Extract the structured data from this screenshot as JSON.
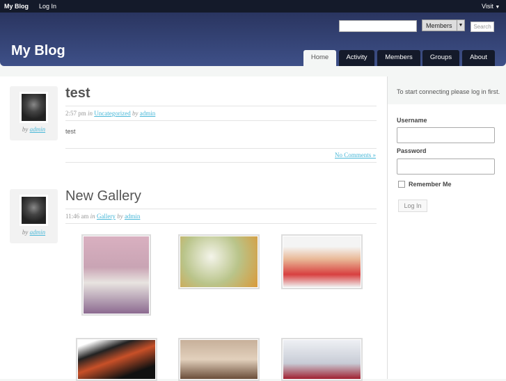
{
  "topbar": {
    "site": "My Blog",
    "login": "Log In",
    "visit": "Visit"
  },
  "header": {
    "title": "My Blog",
    "search_placeholder": "",
    "search_scope": "Members",
    "search_button": "Search",
    "tabs": [
      {
        "label": "Home",
        "active": true
      },
      {
        "label": "Activity"
      },
      {
        "label": "Members"
      },
      {
        "label": "Groups"
      },
      {
        "label": "About"
      }
    ]
  },
  "posts": [
    {
      "title": "test",
      "time": "2:57 pm",
      "in": "in",
      "category": "Uncategorized",
      "by": "by",
      "author": "admin",
      "body": "test",
      "comments": "No Comments »"
    },
    {
      "title": "New Gallery",
      "time": "11:46 am",
      "in": "in",
      "category": "Gallery",
      "by": "by",
      "author": "admin"
    }
  ],
  "sidebar": {
    "intro": "To start connecting please log in first.",
    "username_label": "Username",
    "password_label": "Password",
    "remember": "Remember Me",
    "login_button": "Log In"
  },
  "colors": {
    "topbar": "#141a2a",
    "header": "#33426f",
    "link": "#4ab8d8"
  }
}
